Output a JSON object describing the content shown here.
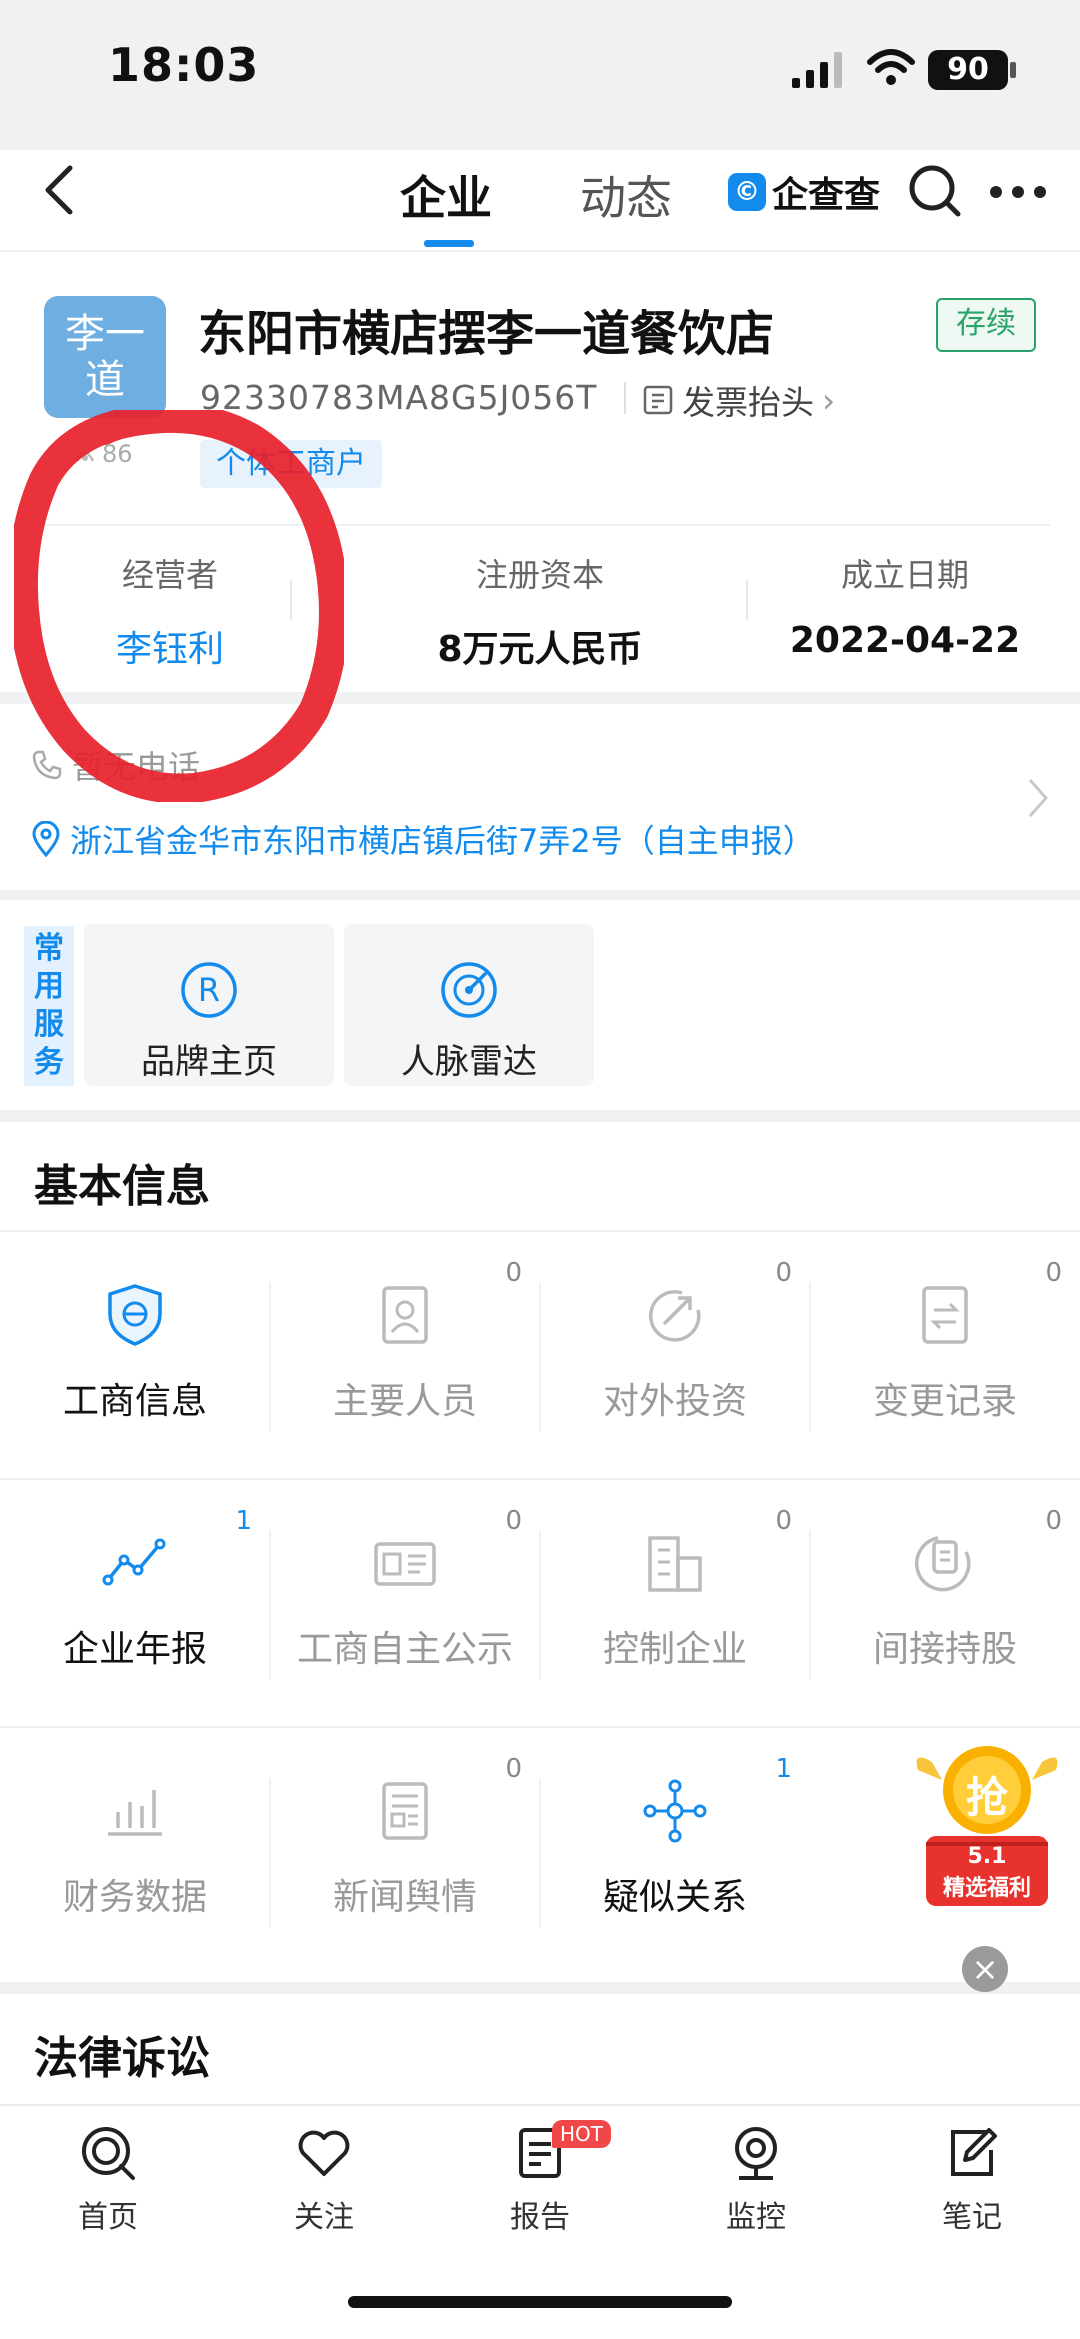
{
  "status_bar": {
    "time": "18:03",
    "battery": "90"
  },
  "nav": {
    "tabs": [
      "企业",
      "动态"
    ],
    "active_tab": "企业",
    "brand_logo_glyph": "©",
    "brand_name": "企查查"
  },
  "company": {
    "logo_text": "李一道",
    "name": "东阳市横店摆李一道餐饮店",
    "status": "存续",
    "credit_code": "92330783MA8G5J056T",
    "invoice_label": "发票抬头",
    "view_count": "86",
    "type_tag": "个体工商户",
    "info": [
      {
        "label": "经营者",
        "value": "李钰利"
      },
      {
        "label": "注册资本",
        "value": "8万元人民币"
      },
      {
        "label": "成立日期",
        "value": "2022-04-22"
      }
    ]
  },
  "contact": {
    "phone": "暂无电话",
    "address": "浙江省金华市东阳市横店镇后街7弄2号（自主申报）"
  },
  "services": {
    "label": "常用服务",
    "items": [
      {
        "label": "品牌主页",
        "icon": "registered-icon"
      },
      {
        "label": "人脉雷达",
        "icon": "radar-icon"
      }
    ]
  },
  "basic_info": {
    "title": "基本信息",
    "rows": [
      [
        {
          "label": "工商信息",
          "count": "",
          "state": "active",
          "icon": "shield-icon"
        },
        {
          "label": "主要人员",
          "count": "0",
          "state": "dim",
          "icon": "person-card-icon"
        },
        {
          "label": "对外投资",
          "count": "0",
          "state": "dim",
          "icon": "investment-icon"
        },
        {
          "label": "变更记录",
          "count": "0",
          "state": "dim",
          "icon": "change-record-icon"
        }
      ],
      [
        {
          "label": "企业年报",
          "count": "1",
          "state": "active",
          "icon": "line-chart-icon"
        },
        {
          "label": "工商自主公示",
          "count": "0",
          "state": "dim",
          "icon": "id-card-icon"
        },
        {
          "label": "控制企业",
          "count": "0",
          "state": "dim",
          "icon": "building-icon"
        },
        {
          "label": "间接持股",
          "count": "0",
          "state": "dim",
          "icon": "holding-icon"
        }
      ],
      [
        {
          "label": "财务数据",
          "count": "",
          "state": "dim",
          "icon": "bar-chart-icon"
        },
        {
          "label": "新闻舆情",
          "count": "0",
          "state": "dim",
          "icon": "news-icon"
        },
        {
          "label": "疑似关系",
          "count": "1",
          "state": "active",
          "icon": "network-icon"
        }
      ]
    ]
  },
  "legal": {
    "title": "法律诉讼"
  },
  "promo": {
    "glyph": "抢",
    "line1": "5.1",
    "line2": "精选福利",
    "close": "×"
  },
  "tabbar": {
    "items": [
      {
        "label": "首页",
        "icon": "home-logo-icon"
      },
      {
        "label": "关注",
        "icon": "heart-icon"
      },
      {
        "label": "报告",
        "icon": "report-icon"
      },
      {
        "label": "监控",
        "icon": "camera-icon"
      },
      {
        "label": "笔记",
        "icon": "note-edit-icon"
      }
    ],
    "hot_badge": "HOT"
  },
  "colors": {
    "accent": "#128bed",
    "status_green": "#2aa36a",
    "annotation_red": "#e8212b"
  }
}
